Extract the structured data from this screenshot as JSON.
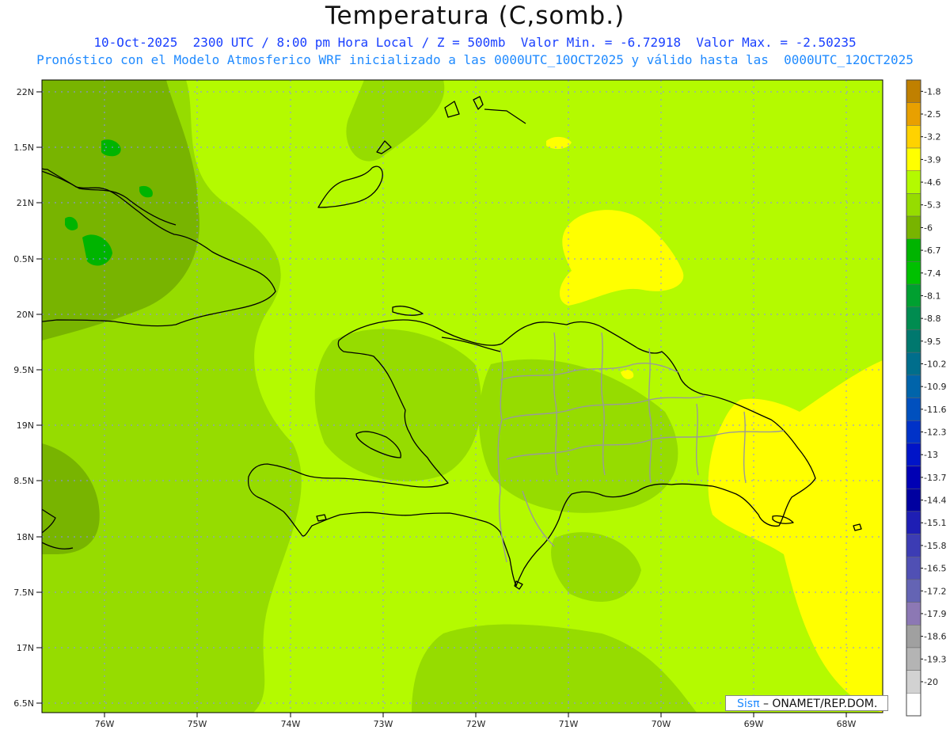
{
  "header": {
    "title": "Temperatura (C,somb.)",
    "line1": "10-Oct-2025  2300 UTC / 8:00 pm Hora Local / Z = 500mb  Valor Min. = -6.72918  Valor Max. = -2.50235",
    "line2": "Pronóstico con el Modelo Atmosferico WRF inicializado a las 0000UTC_10OCT2025 y válido hasta las  0000UTC_12OCT2025"
  },
  "map": {
    "lat_labels": [
      "22N",
      "1.5N",
      "21N",
      "0.5N",
      "20N",
      "9.5N",
      "19N",
      "8.5N",
      "18N",
      "7.5N",
      "17N",
      "6.5N"
    ],
    "lon_labels": [
      "76W",
      "75W",
      "74W",
      "73W",
      "72W",
      "71W",
      "70W",
      "69W",
      "68W"
    ],
    "lat_range": [
      16.5,
      22.1
    ],
    "lon_range": [
      -76.7,
      -67.6
    ],
    "grid": "dotted"
  },
  "colorbar": {
    "labels": [
      "-1.8",
      "-2.5",
      "-3.2",
      "-3.9",
      "-4.6",
      "-5.3",
      "-6",
      "-6.7",
      "-7.4",
      "-8.1",
      "-8.8",
      "-9.5",
      "-10.2",
      "-10.9",
      "-11.6",
      "-12.3",
      "-13",
      "-13.7",
      "-14.4",
      "-15.1",
      "-15.8",
      "-16.5",
      "-17.2",
      "-17.9",
      "-18.6",
      "-19.3",
      "-20"
    ],
    "colors": [
      "#c08000",
      "#e8a000",
      "#ffd200",
      "#ffff00",
      "#b4fa00",
      "#96dc00",
      "#78b400",
      "#00b400",
      "#00c000",
      "#00a030",
      "#008c50",
      "#00786e",
      "#006e8c",
      "#0064aa",
      "#0050be",
      "#0032c8",
      "#0014c8",
      "#0000b4",
      "#0000a0",
      "#1e1eb4",
      "#3c3cb4",
      "#5050b4",
      "#6464b4",
      "#8c78b4",
      "#a0a0a0",
      "#b4b4b4",
      "#d2d2d2",
      "#ffffff"
    ]
  },
  "credit": {
    "sis": "Sisπ",
    "text": "– ONAMET/REP.DOM."
  }
}
